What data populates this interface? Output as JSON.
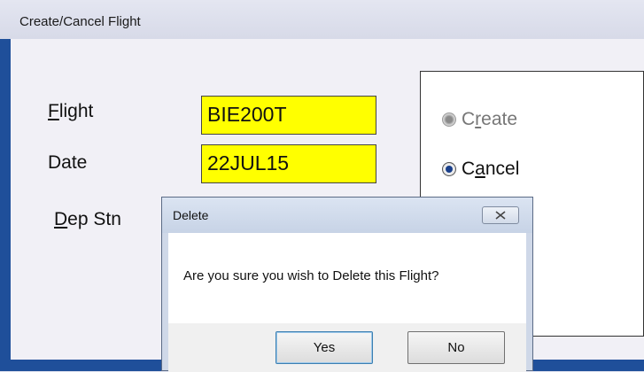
{
  "window": {
    "title": "Create/Cancel Flight"
  },
  "form": {
    "flight_label_hotkey": "F",
    "flight_label_rest": "light",
    "flight_value": "BIE200T",
    "date_label": "Date",
    "date_value": "22JUL15",
    "dep_label_hotkey": "D",
    "dep_label_rest": "ep Stn"
  },
  "action": {
    "create_prefix": "C",
    "create_hotkey": "r",
    "create_rest": "eate",
    "cancel_prefix": "C",
    "cancel_hotkey": "a",
    "cancel_rest": "ncel",
    "selected": "Cancel"
  },
  "dialog": {
    "title": "Delete",
    "message": "Are you sure you wish to Delete this Flight?",
    "yes_label": "Yes",
    "no_label": "No",
    "close_icon": "close-icon"
  },
  "colors": {
    "field_bg": "#ffff00",
    "window_frame": "#1f4f9a"
  }
}
